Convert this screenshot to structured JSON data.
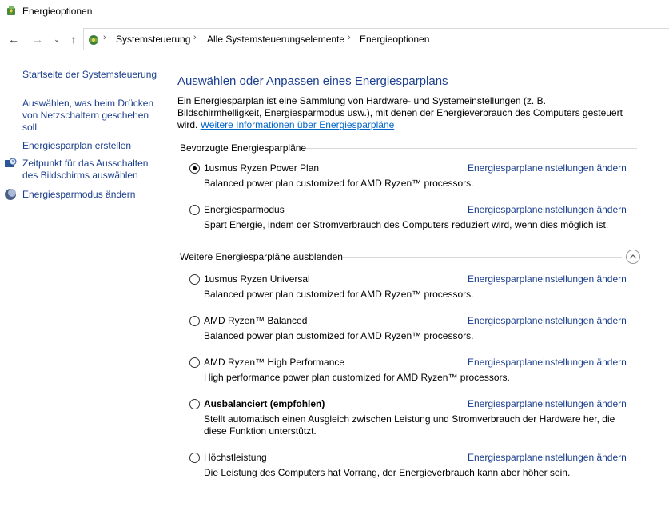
{
  "window": {
    "title": "Energieoptionen"
  },
  "address": {
    "breadcrumbs": [
      "Systemsteuerung",
      "Alle Systemsteuerungselemente",
      "Energieoptionen"
    ]
  },
  "sidebar": {
    "home": "Startseite der Systemsteuerung",
    "links": [
      "Auswählen, was beim Drücken von Netzschaltern geschehen soll",
      "Energiesparplan erstellen",
      "Zeitpunkt für das Ausschalten des Bildschirms auswählen",
      "Energiesparmodus ändern"
    ]
  },
  "main": {
    "heading": "Auswählen oder Anpassen eines Energiesparplans",
    "intro": "Ein Energiesparplan ist eine Sammlung von Hardware- und Systemeinstellungen (z. B. Bildschirmhelligkeit, Energiesparmodus usw.), mit denen der Energieverbrauch des Computers gesteuert wird.",
    "intro_link": "Weitere Informationen über Energiesparpläne",
    "preferred_header": "Bevorzugte Energiesparpläne",
    "more_header": "Weitere Energiesparpläne ausblenden",
    "change_link": "Energiesparplaneinstellungen ändern",
    "preferred_plans": [
      {
        "name": "1usmus Ryzen Power Plan",
        "desc": "Balanced power plan customized for AMD Ryzen™ processors.",
        "selected": true
      },
      {
        "name": "Energiesparmodus",
        "desc": "Spart Energie, indem der Stromverbrauch des Computers reduziert wird, wenn dies möglich ist.",
        "selected": false
      }
    ],
    "more_plans": [
      {
        "name": "1usmus Ryzen Universal",
        "desc": "Balanced power plan customized for AMD Ryzen™ processors.",
        "selected": false
      },
      {
        "name": "AMD Ryzen™ Balanced",
        "desc": "Balanced power plan customized for AMD Ryzen™ processors.",
        "selected": false
      },
      {
        "name": "AMD Ryzen™ High Performance",
        "desc": "High performance power plan customized for AMD Ryzen™ processors.",
        "selected": false
      },
      {
        "name": "Ausbalanciert (empfohlen)",
        "desc": "Stellt automatisch einen Ausgleich zwischen Leistung und Stromverbrauch der Hardware her, die diese Funktion unterstützt.",
        "selected": false
      },
      {
        "name": "Höchstleistung",
        "desc": "Die Leistung des Computers hat Vorrang, der Energieverbrauch kann aber höher sein.",
        "selected": false
      }
    ]
  }
}
